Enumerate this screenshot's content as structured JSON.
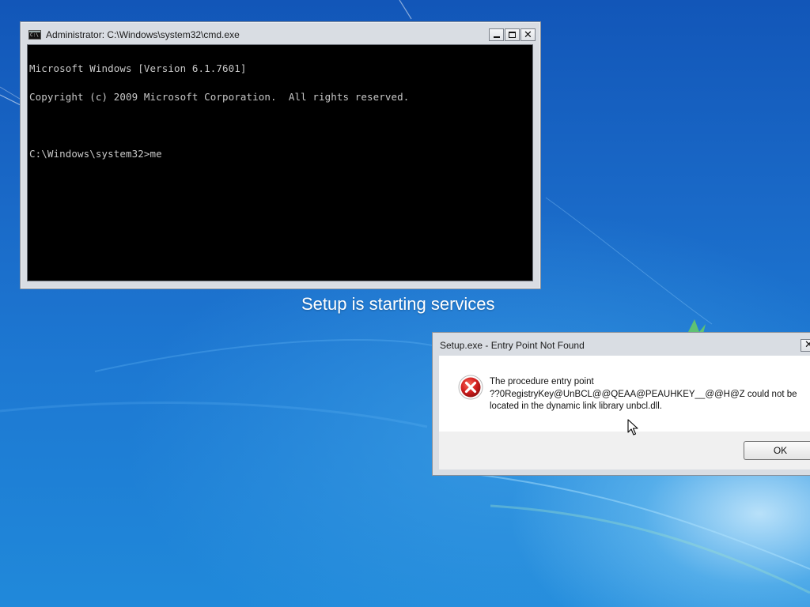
{
  "cmd_window": {
    "title": "Administrator: C:\\Windows\\system32\\cmd.exe",
    "console_lines": [
      "Microsoft Windows [Version 6.1.7601]",
      "Copyright (c) 2009 Microsoft Corporation.  All rights reserved.",
      "",
      "C:\\Windows\\system32>me"
    ],
    "buttons": {
      "minimize": "minimize",
      "maximize": "maximize",
      "close": "✕"
    }
  },
  "setup_status": "Setup is starting services",
  "error_dialog": {
    "title": "Setup.exe - Entry Point Not Found",
    "close": "✕",
    "message_lines": [
      "The procedure entry point",
      "??0RegistryKey@UnBCL@@QEAA@PEAUHKEY__@@H@Z could not be",
      "located in the dynamic link library unbcl.dll."
    ],
    "ok_label": "OK",
    "icon": "error-icon"
  },
  "colors": {
    "desktop_blue": "#1a6ac8",
    "console_bg": "#000000",
    "console_text": "#c8c8c8",
    "error_red": "#d42020"
  }
}
